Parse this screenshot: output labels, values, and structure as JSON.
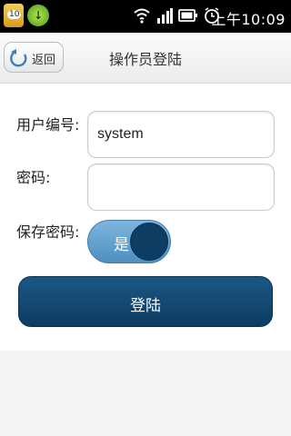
{
  "status_bar": {
    "notification_badge": "10",
    "time": "上午10:09",
    "icons": [
      "wifi-icon",
      "signal-icon",
      "battery-icon",
      "alarm-icon"
    ]
  },
  "title_bar": {
    "back_label": "返回",
    "title": "操作员登陆"
  },
  "form": {
    "user_id_label": "用户编号:",
    "user_id_value": "system",
    "password_label": "密码:",
    "password_value": "",
    "save_password_label": "保存密码:",
    "save_password_toggle": "是",
    "login_button": "登陆"
  },
  "colors": {
    "accent": "#0d3d63",
    "toggle": "#5a98c7"
  }
}
